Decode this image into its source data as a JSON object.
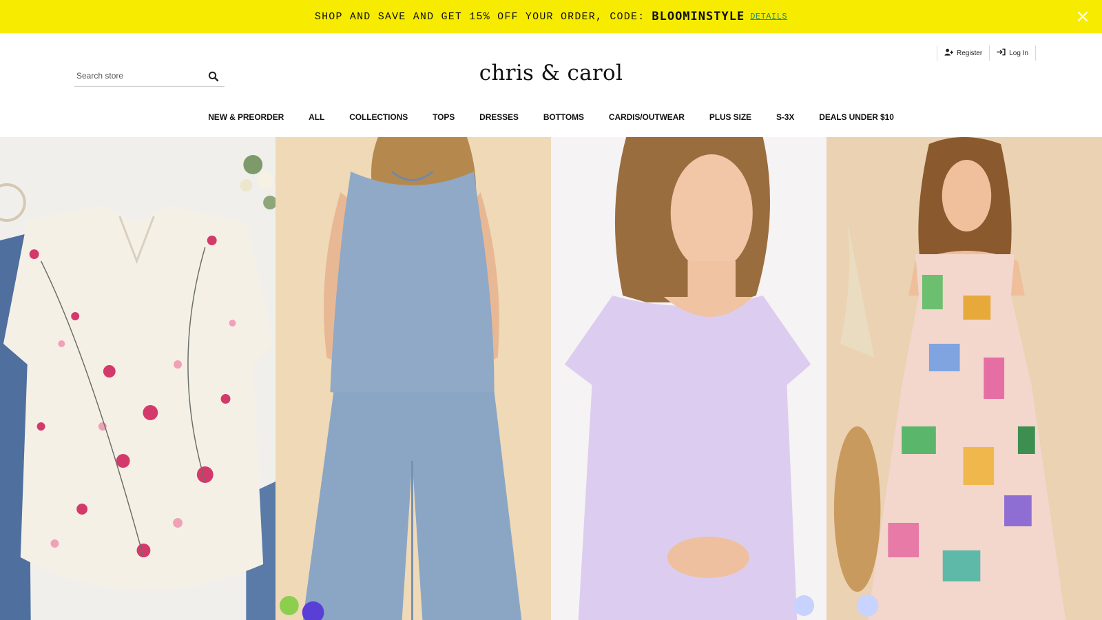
{
  "promo": {
    "text": "SHOP AND SAVE AND GET 15% OFF YOUR ORDER, CODE:",
    "code": "BLOOMINSTYLE",
    "details_label": "DETAILS",
    "close_icon": "close-icon",
    "background": "#f7ec00"
  },
  "search": {
    "placeholder": "Search store",
    "icon": "search-icon"
  },
  "brand": {
    "logo_text": "chris & carol"
  },
  "account": {
    "register_label": "Register",
    "register_icon": "user-plus-icon",
    "login_label": "Log In",
    "login_icon": "sign-in-icon"
  },
  "nav": {
    "items": [
      "NEW & PREORDER",
      "ALL",
      "COLLECTIONS",
      "TOPS",
      "DRESSES",
      "BOTTOMS",
      "CARDIS/OUTWEAR",
      "PLUS SIZE",
      "S-3X",
      "DEALS UNDER $10"
    ]
  },
  "hero": {
    "panels": [
      {
        "subject": "floral-blouse-image",
        "background": "#f1efeb"
      },
      {
        "subject": "blue-linen-set-image",
        "background": "#efd9b7"
      },
      {
        "subject": "lavender-tee-dress-image",
        "background": "#f5f3f4"
      },
      {
        "subject": "tropical-print-dress-image",
        "background": "#ead2b2"
      }
    ]
  }
}
